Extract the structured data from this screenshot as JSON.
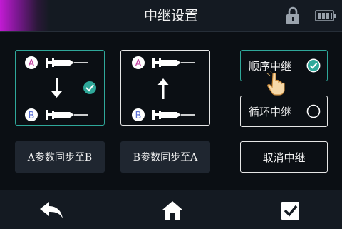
{
  "header": {
    "title": "中继设置",
    "lock_icon": "lock-icon",
    "battery_icon": "battery-icon"
  },
  "direction_panels": [
    {
      "top_label": "A",
      "bottom_label": "B",
      "arrow": "down",
      "selected": true
    },
    {
      "top_label": "A",
      "bottom_label": "B",
      "arrow": "up",
      "selected": false
    }
  ],
  "sync": {
    "a_to_b_label": "A参数同步至B",
    "b_to_a_label": "B参数同步至A"
  },
  "relay_mode": {
    "sequential_label": "顺序中继",
    "sequential_selected": true,
    "loop_label": "循环中继",
    "loop_selected": false,
    "cancel_label": "取消中继"
  },
  "footer": {
    "back_icon": "back-icon",
    "home_icon": "home-icon",
    "confirm_icon": "confirm-icon"
  },
  "colors": {
    "accent_teal": "#2fa89a",
    "label_a": "#c23fa0",
    "label_b": "#5a6fd6",
    "background": "#0b0f14"
  }
}
